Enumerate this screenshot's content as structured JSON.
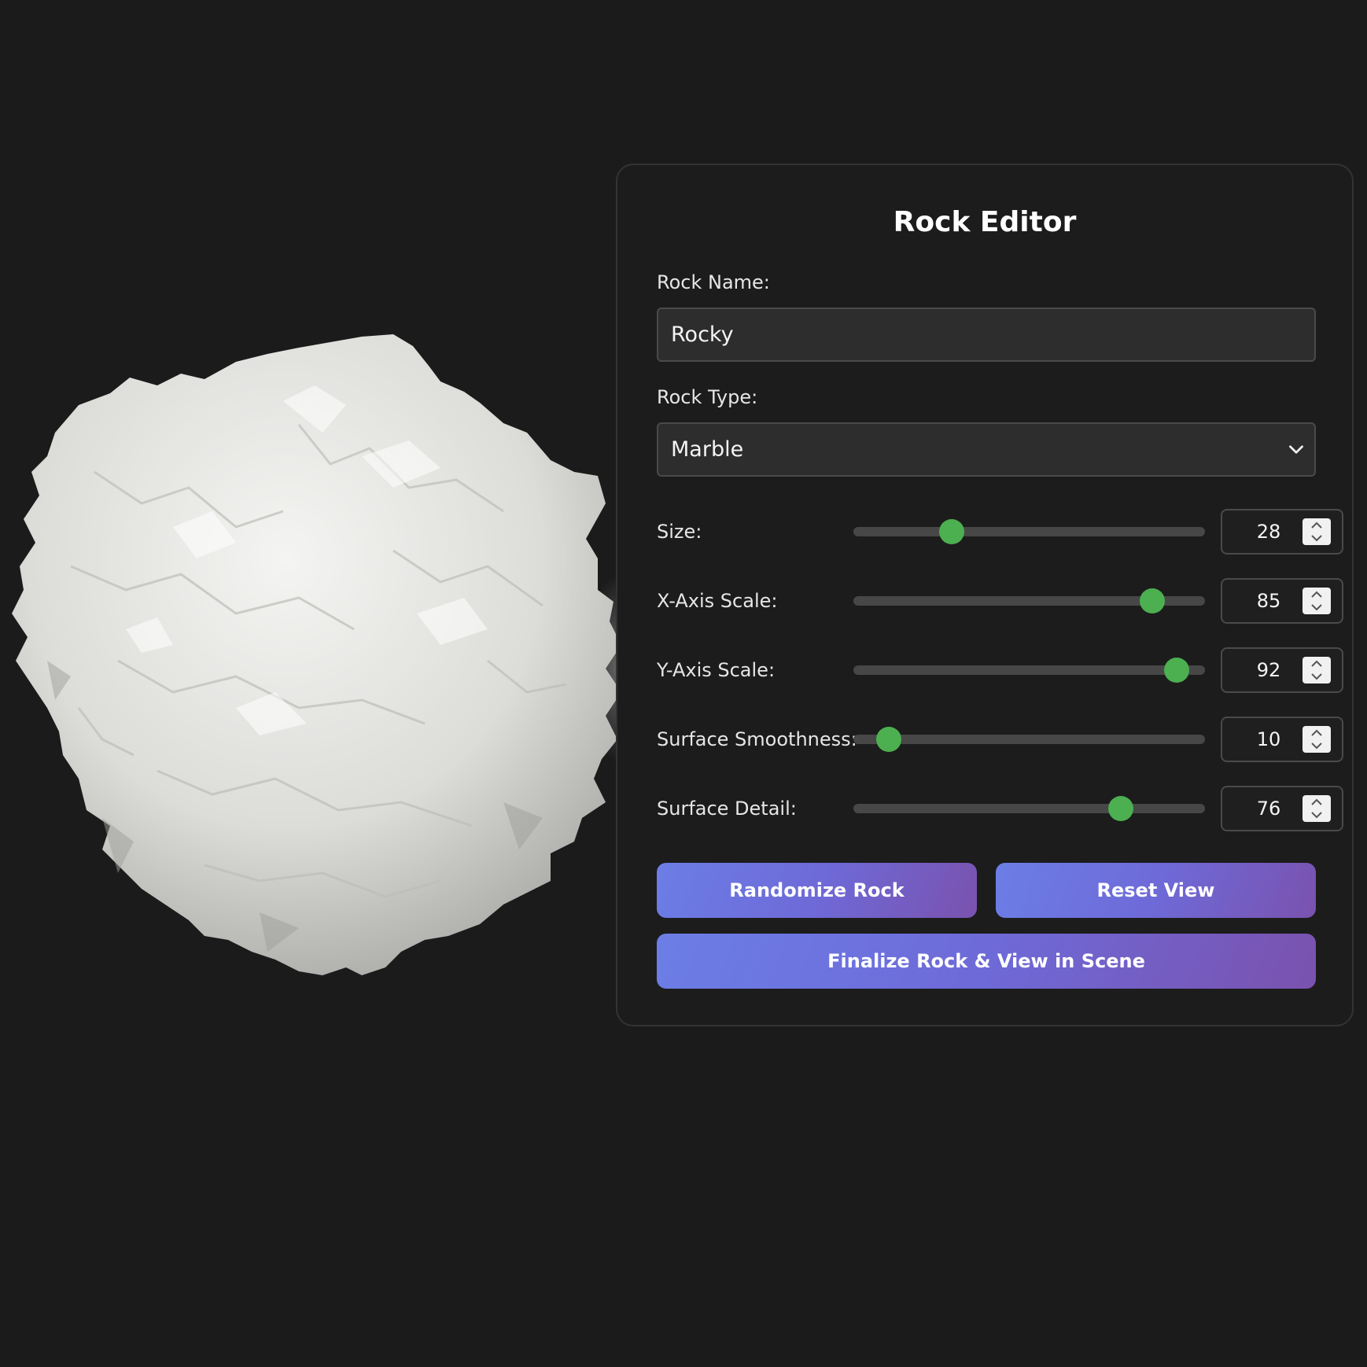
{
  "editor": {
    "title": "Rock Editor",
    "name_label": "Rock Name:",
    "name_value": "Rocky",
    "type_label": "Rock Type:",
    "type_value": "Marble"
  },
  "sliders": {
    "size": {
      "label": "Size:",
      "value": "28"
    },
    "x_scale": {
      "label": "X-Axis Scale:",
      "value": "85"
    },
    "y_scale": {
      "label": "Y-Axis Scale:",
      "value": "92"
    },
    "smoothness": {
      "label": "Surface Smoothness:",
      "value": "10"
    },
    "detail": {
      "label": "Surface Detail:",
      "value": "76"
    }
  },
  "buttons": {
    "randomize": "Randomize Rock",
    "reset": "Reset View",
    "finalize": "Finalize Rock & View in Scene"
  },
  "colors": {
    "background": "#1b1b1b",
    "slider_thumb": "#4caf50",
    "button_gradient_start": "#6c7ee6",
    "button_gradient_end": "#7a52ae"
  },
  "icons": {
    "select_arrow": "chevron-down-icon",
    "spinner": "up-down-arrows-icon"
  }
}
